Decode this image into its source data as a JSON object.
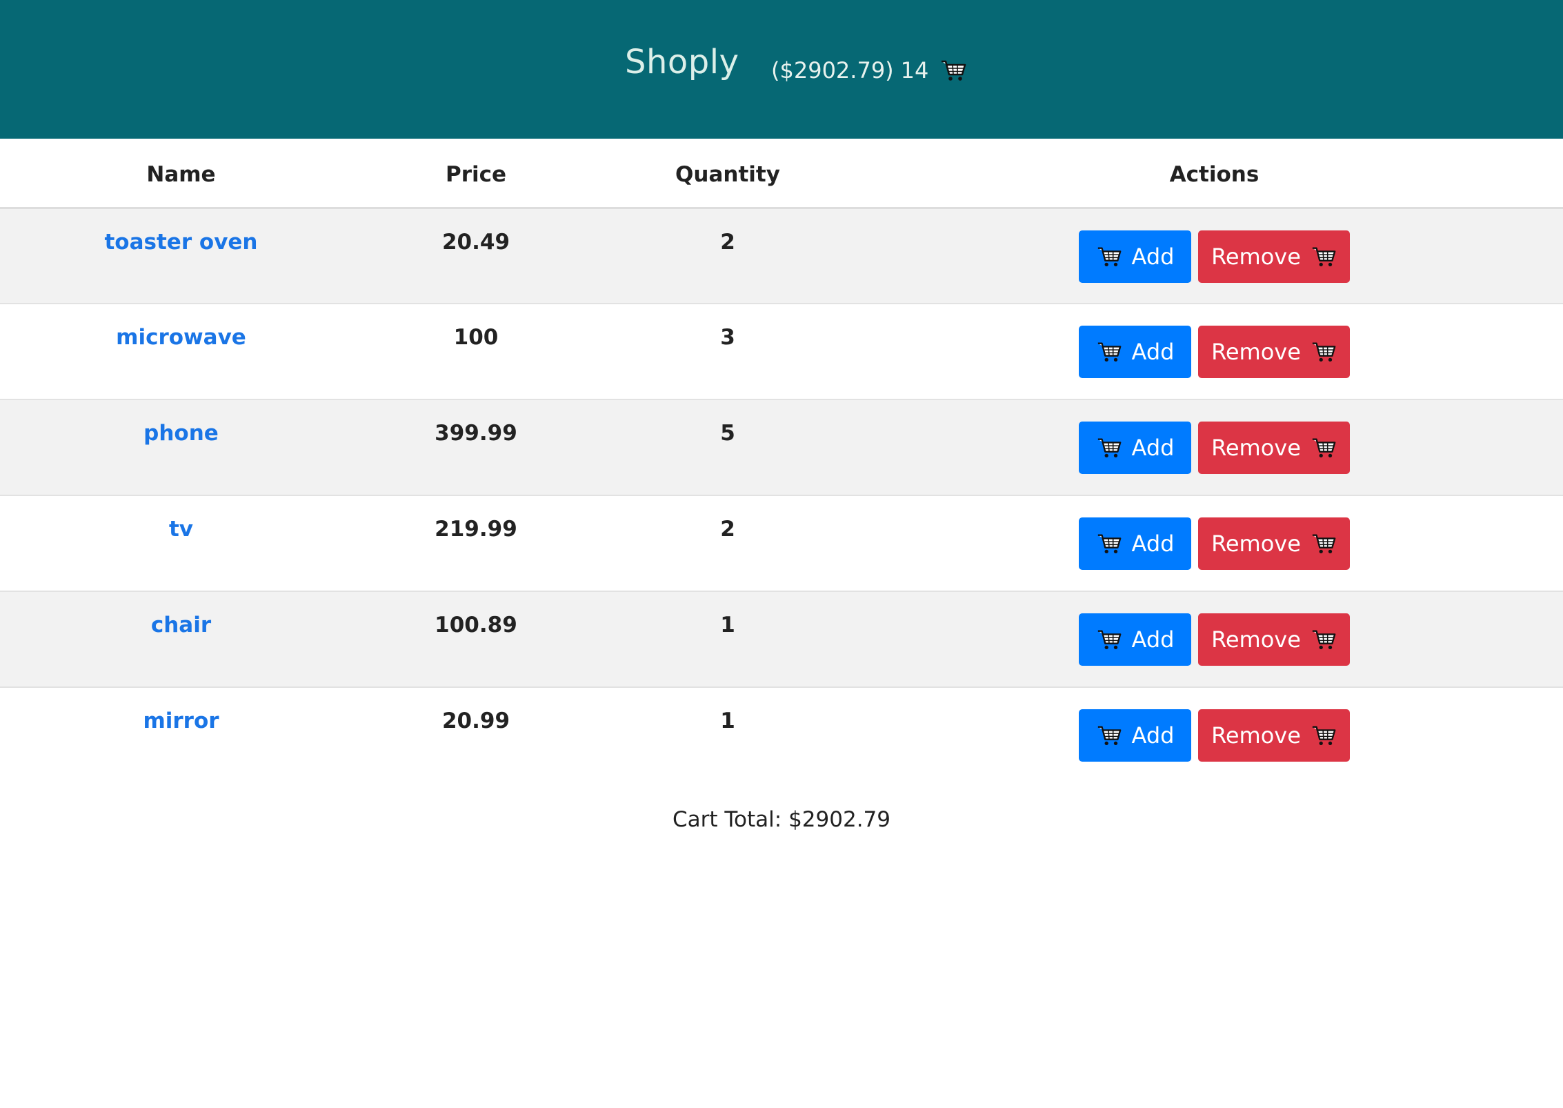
{
  "header": {
    "brand": "Shoply",
    "cart_total_short": "($2902.79)",
    "cart_count": "14",
    "cart_icon": "shopping-cart-icon",
    "background_color": "#066874"
  },
  "table": {
    "columns": [
      "Name",
      "Price",
      "Quantity",
      "Actions"
    ],
    "rows": [
      {
        "name": "toaster oven",
        "price": "20.49",
        "quantity": "2",
        "add_label": "Add",
        "remove_label": "Remove"
      },
      {
        "name": "microwave",
        "price": "100",
        "quantity": "3",
        "add_label": "Add",
        "remove_label": "Remove"
      },
      {
        "name": "phone",
        "price": "399.99",
        "quantity": "5",
        "add_label": "Add",
        "remove_label": "Remove"
      },
      {
        "name": "tv",
        "price": "219.99",
        "quantity": "2",
        "add_label": "Add",
        "remove_label": "Remove"
      },
      {
        "name": "chair",
        "price": "100.89",
        "quantity": "1",
        "add_label": "Add",
        "remove_label": "Remove"
      },
      {
        "name": "mirror",
        "price": "20.99",
        "quantity": "1",
        "add_label": "Add",
        "remove_label": "Remove"
      }
    ]
  },
  "footer": {
    "cart_total": "Cart Total: $2902.79"
  },
  "colors": {
    "add_button": "#007bff",
    "remove_button": "#dc3545",
    "link": "#1a75e6"
  }
}
